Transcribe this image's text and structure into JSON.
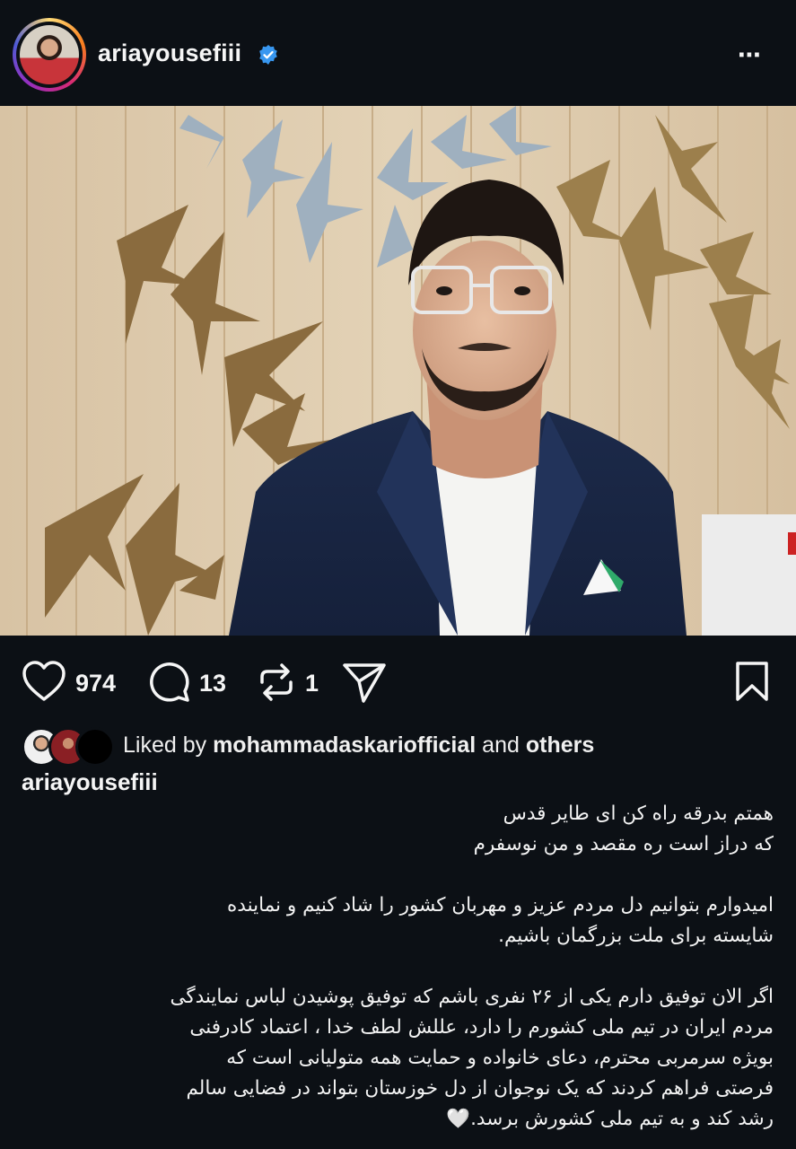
{
  "post": {
    "username": "ariayousefiii",
    "more_icon": "⋯"
  },
  "actions": {
    "likes": "974",
    "comments": "13",
    "reposts": "1"
  },
  "liked_by": {
    "prefix": "Liked by ",
    "user": "mohammadaskariofficial",
    "mid": " and ",
    "suffix": "others"
  },
  "caption": {
    "username": "ariayousefiii",
    "lines": [
      "همتم بدرقه راه کن ای طایر قدس",
      "که دراز است ره مقصد و من نوسفرم",
      "امیدوارم بتوانیم دل مردم عزیز و مهربان کشور را شاد کنیم و نماینده",
      "شایسته برای ملت بزرگمان باشیم.",
      "اگر الان توفیق دارم یکی از ۲۶ نفری باشم که توفیق پوشیدن لباس نمایندگی",
      "مردم ایران در تیم ملی کشورم را دارد، عللش لطف خدا ، اعتماد کادرفنی",
      "بویژه سرمربی محترم، دعای خانواده و حمایت همه متولیانی است که",
      "فرصتی فراهم کردند که یک نوجوان از دل خوزستان بتواند در فضایی سالم",
      "رشد کند و  به تیم ملی کشورش برسد.🤍"
    ]
  },
  "colors": {
    "background": "#0c1015",
    "verified": "#3897f0",
    "text": "#f5f5f5"
  }
}
